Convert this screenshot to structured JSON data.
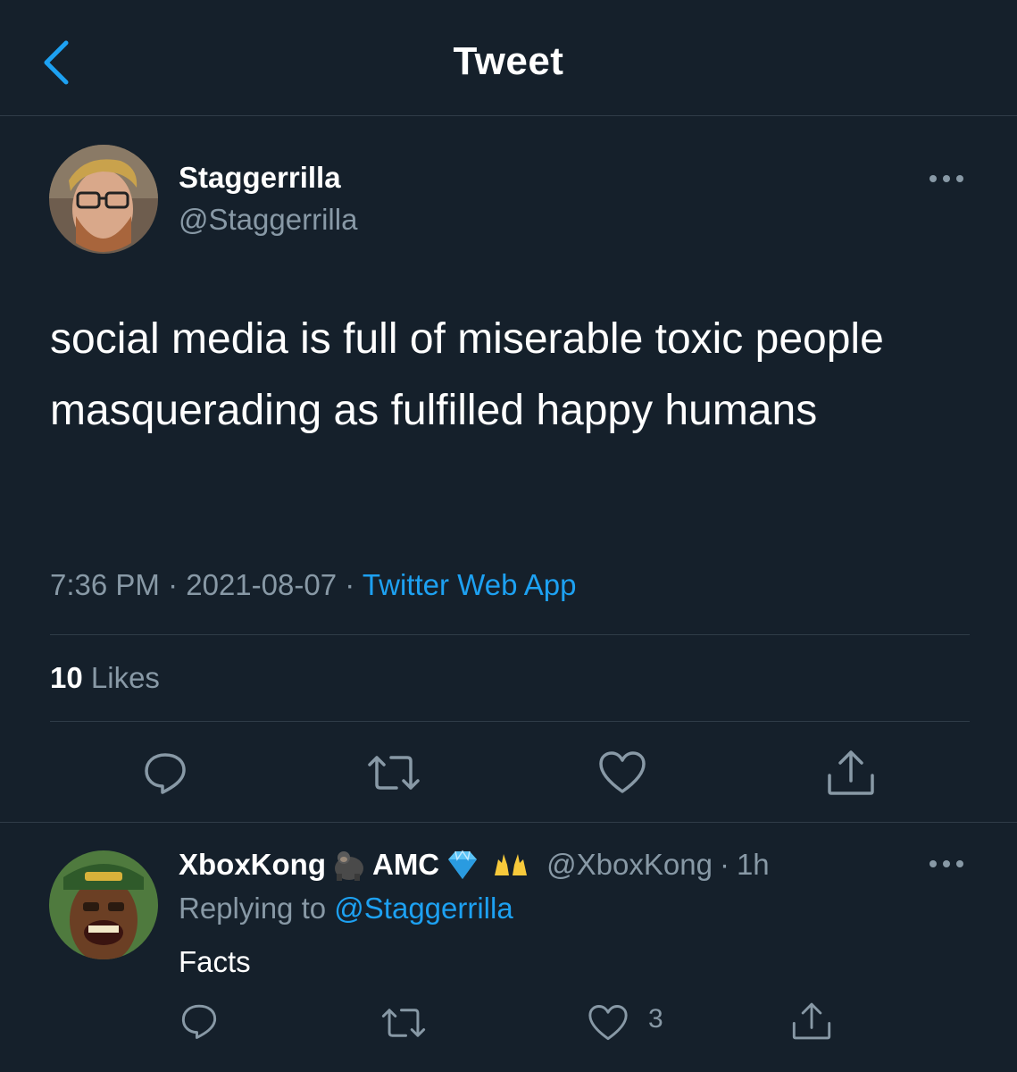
{
  "header": {
    "title": "Tweet",
    "back_icon": "chevron-left-icon"
  },
  "tweet": {
    "author_name": "Staggerrilla",
    "author_handle": "@Staggerrilla",
    "text": "social media is full of miserable toxic people masquerading as fulfilled happy humans",
    "time": "7:36 PM",
    "date": "2021-08-07",
    "separator": "·",
    "source": "Twitter Web App",
    "likes_count": "10",
    "likes_label": "Likes",
    "actions": [
      "reply-icon",
      "retweet-icon",
      "heart-icon",
      "share-icon"
    ]
  },
  "reply": {
    "author_name": "XboxKong",
    "author_name_suffix": "AMC",
    "emojis": [
      "gorilla",
      "gem",
      "raising-hands"
    ],
    "author_handle": "@XboxKong",
    "time_sep": "·",
    "time": "1h",
    "replying_label": "Replying to",
    "replying_to": "@Staggerrilla",
    "text": "Facts",
    "like_count": "3",
    "actions": [
      "reply-icon",
      "retweet-icon",
      "heart-icon",
      "share-icon"
    ]
  },
  "colors": {
    "background": "#15202b",
    "accent": "#1da1f2",
    "secondary_text": "#8899a6",
    "divider": "#2f3c48"
  }
}
